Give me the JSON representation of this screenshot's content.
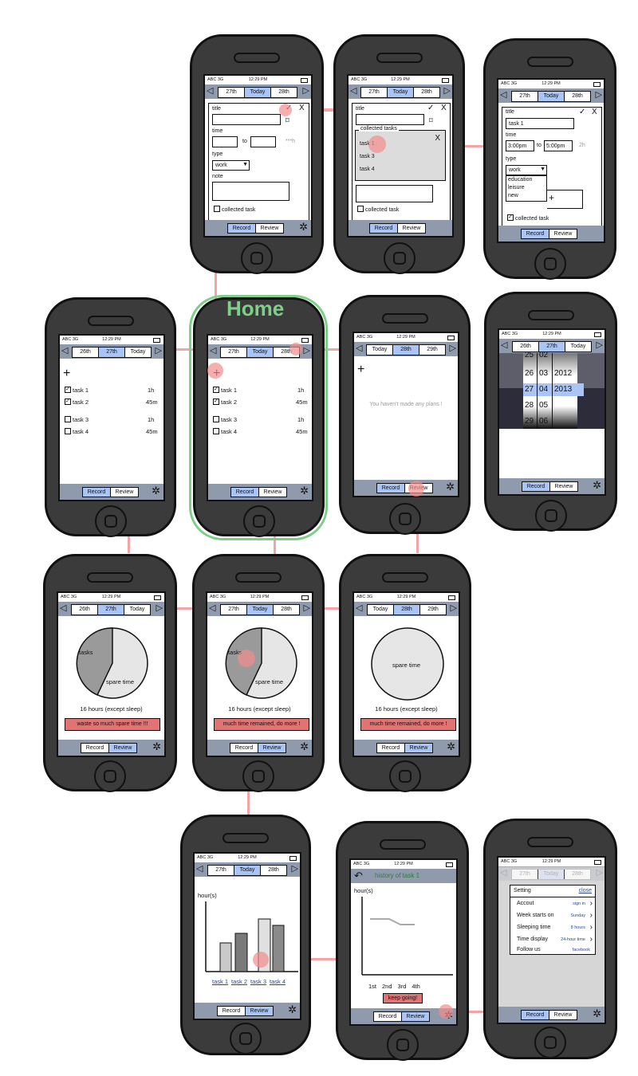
{
  "title": "Home",
  "status": {
    "carrier": "ABC 3G",
    "time": "12:29 PM"
  },
  "nav": {
    "record": "Record",
    "review": "Review"
  },
  "dates": {
    "d26": "26th",
    "d27": "27th",
    "d28": "28th",
    "d29": "29th",
    "today": "Today"
  },
  "form": {
    "title_label": "title",
    "time_label": "time",
    "to": "to",
    "duration_ph": "***h",
    "type_label": "type",
    "note_label": "note",
    "type_value": "work",
    "collected_task": "collected task",
    "check": "✓",
    "close": "X",
    "collected_tasks_title": "collected tasks",
    "filled_title": "task 1",
    "start_time": "3:00pm",
    "end_time": "5:00pm",
    "duration": "2h",
    "type_options": [
      "education",
      "leisure",
      "new"
    ]
  },
  "tasks": [
    {
      "name": "task 1",
      "dur": "1h",
      "checked": true
    },
    {
      "name": "task 2",
      "dur": "45m",
      "checked": true
    },
    {
      "name": "task 3",
      "dur": "1h",
      "checked": false
    },
    {
      "name": "task 4",
      "dur": "45m",
      "checked": false
    }
  ],
  "collected": [
    "task 1",
    "task 3",
    "task 4"
  ],
  "no_plans": "You haven't made any plans !",
  "picker": {
    "days": [
      "25",
      "26",
      "27",
      "28",
      "29"
    ],
    "months": [
      "02",
      "03",
      "04",
      "05",
      "06"
    ],
    "years": [
      "",
      "2012",
      "2013",
      "",
      ""
    ]
  },
  "review": {
    "tasks_label": "tasks",
    "spare_label": "spare time",
    "hours_note": "16 hours (except sleep)",
    "warn_waste": "waste so much spare time !!!",
    "warn_more": "much time remained, do more !"
  },
  "bar": {
    "ylabel": "hour(s)",
    "tasks": [
      "task 1",
      "task 2",
      "task 3",
      "task 4"
    ]
  },
  "history": {
    "title": "history of task 1",
    "ylabel": "hour(s)",
    "xticks": [
      "1st",
      "2nd",
      "3rd",
      "4th"
    ],
    "keep": "keep going!"
  },
  "settings": {
    "title": "Setting",
    "close": "close",
    "rows": [
      {
        "label": "Accout",
        "value": "sign in"
      },
      {
        "label": "Week starts on",
        "value": "Sunday"
      },
      {
        "label": "Sleeping time",
        "value": "8 hours"
      },
      {
        "label": "Time display",
        "value": "24-hour time"
      },
      {
        "label": "Follow us",
        "value": "facebook"
      }
    ]
  },
  "colors": {
    "accent": "#a9c4f5",
    "bar": "#8f9bad",
    "warn": "#e27373",
    "connector": "#f3a4a4",
    "home": "#7fcf8a",
    "phone": "#3b3b3b"
  }
}
